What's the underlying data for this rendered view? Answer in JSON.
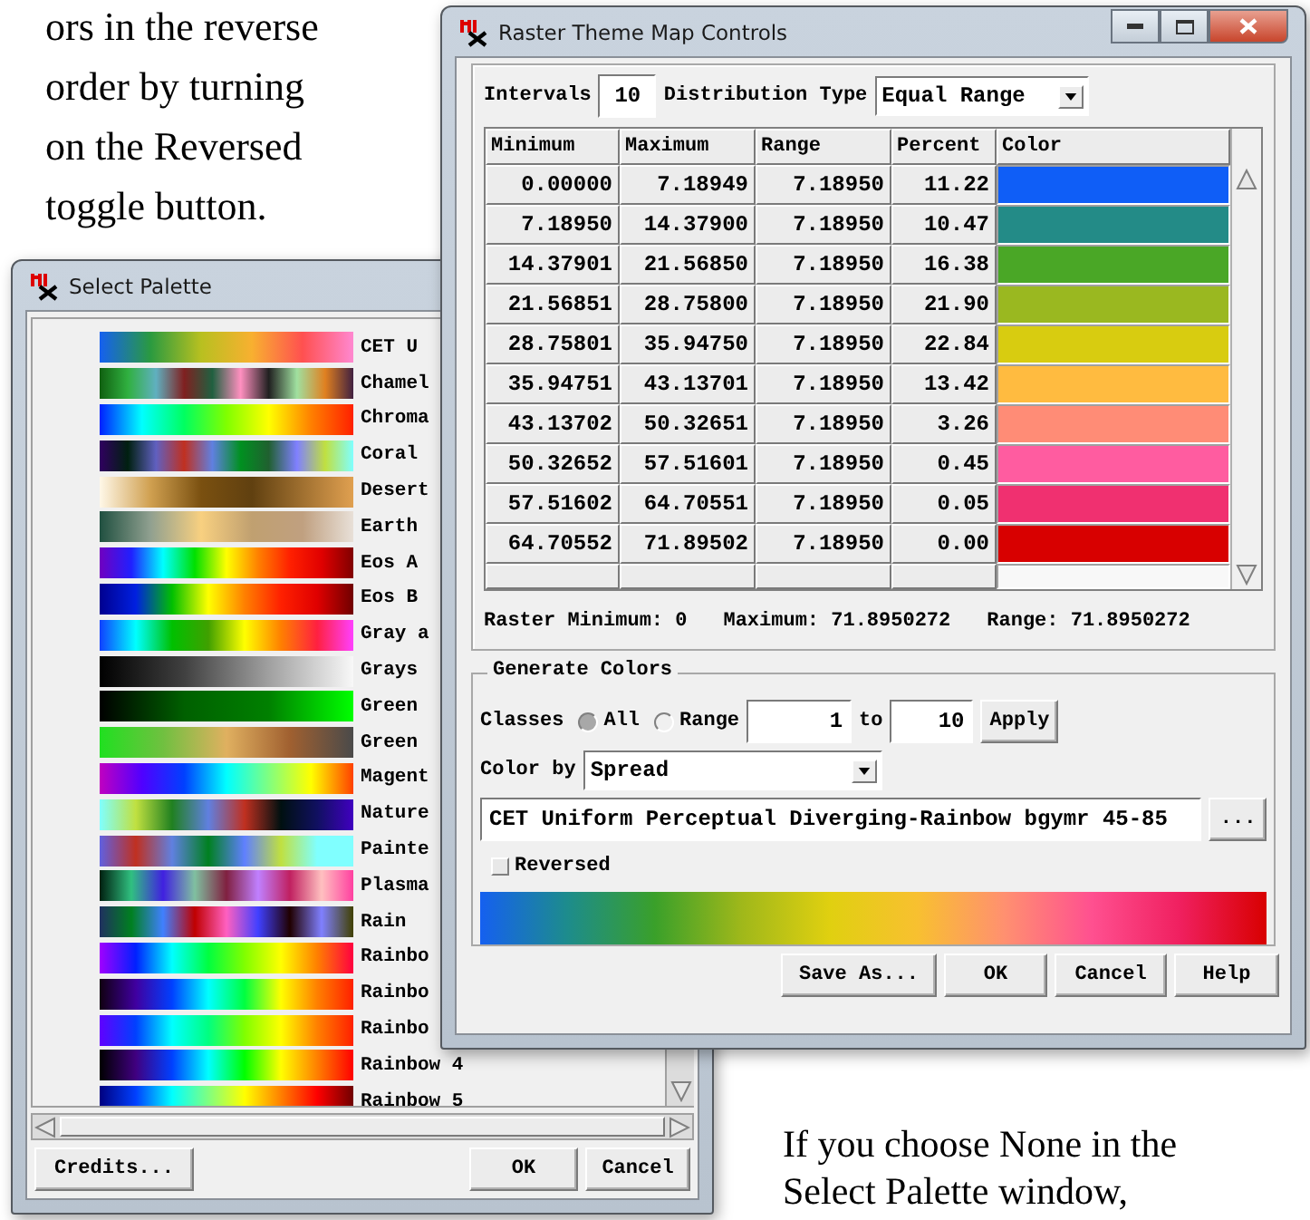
{
  "document": {
    "top_paragraph": "ors in the reverse\norder by turning\non the Reversed\ntoggle button.",
    "bottom_paragraph": "If you choose None in the\nSelect Palette window,"
  },
  "select_palette": {
    "title": "Select Palette",
    "palettes": [
      {
        "name": "CET U"
      },
      {
        "name": "Chamel"
      },
      {
        "name": "Chroma"
      },
      {
        "name": "Coral"
      },
      {
        "name": "Desert"
      },
      {
        "name": "Earth"
      },
      {
        "name": "Eos A"
      },
      {
        "name": "Eos B"
      },
      {
        "name": "Gray a"
      },
      {
        "name": "Grays"
      },
      {
        "name": "Green"
      },
      {
        "name": "Green"
      },
      {
        "name": "Magent"
      },
      {
        "name": "Nature"
      },
      {
        "name": "Painte"
      },
      {
        "name": "Plasma"
      },
      {
        "name": "Rain"
      },
      {
        "name": "Rainbo"
      },
      {
        "name": "Rainbo"
      },
      {
        "name": "Rainbo"
      },
      {
        "name": "Rainbow 4"
      },
      {
        "name": "Rainbow 5"
      }
    ],
    "buttons": [
      "Credits...",
      "OK",
      "Cancel"
    ]
  },
  "raster_window": {
    "title": "Raster Theme Map Controls",
    "intervals_label": "Intervals",
    "intervals": "10",
    "distribution_label": "Distribution Type",
    "distribution_value": "Equal Range",
    "table": {
      "columns": [
        "Minimum",
        "Maximum",
        "Range",
        "Percent",
        "Color"
      ],
      "rows": [
        {
          "minimum": "0.00000",
          "maximum": "7.18949",
          "range": "7.18950",
          "percent": "11.22",
          "color": "#0f5ef7"
        },
        {
          "minimum": "7.18950",
          "maximum": "14.37900",
          "range": "7.18950",
          "percent": "10.47",
          "color": "#238b87"
        },
        {
          "minimum": "14.37901",
          "maximum": "21.56850",
          "range": "7.18950",
          "percent": "16.38",
          "color": "#4aa726"
        },
        {
          "minimum": "21.56851",
          "maximum": "28.75800",
          "range": "7.18950",
          "percent": "21.90",
          "color": "#9ab820"
        },
        {
          "minimum": "28.75801",
          "maximum": "35.94750",
          "range": "7.18950",
          "percent": "22.84",
          "color": "#d8cc10"
        },
        {
          "minimum": "35.94751",
          "maximum": "43.13701",
          "range": "7.18950",
          "percent": "13.42",
          "color": "#ffbb40"
        },
        {
          "minimum": "43.13702",
          "maximum": "50.32651",
          "range": "7.18950",
          "percent": "3.26",
          "color": "#ff8c76"
        },
        {
          "minimum": "50.32652",
          "maximum": "57.51601",
          "range": "7.18950",
          "percent": "0.45",
          "color": "#ff5ca0"
        },
        {
          "minimum": "57.51602",
          "maximum": "64.70551",
          "range": "7.18950",
          "percent": "0.05",
          "color": "#f03070"
        },
        {
          "minimum": "64.70552",
          "maximum": "71.89502",
          "range": "7.18950",
          "percent": "0.00",
          "color": "#d80000"
        }
      ]
    },
    "stats": [
      "Raster Minimum: 0",
      "Maximum: 71.8950272",
      "Range: 71.8950272"
    ],
    "generate_colors": {
      "title": "Generate Colors",
      "classes_label": "Classes",
      "options": [
        {
          "label": "All",
          "selected": true
        },
        {
          "label": "Range",
          "selected": false
        }
      ],
      "from": "1",
      "to_label": "to",
      "to": "10",
      "apply": "Apply",
      "color_by_label": "Color by",
      "color_by_value": "Spread",
      "palette_name": "CET Uniform Perceptual Diverging-Rainbow bgymr 45-85",
      "browse": "...",
      "reversed": {
        "label": "Reversed",
        "checked": false
      }
    },
    "buttons": [
      "Save As...",
      "OK",
      "Cancel",
      "Help"
    ]
  }
}
